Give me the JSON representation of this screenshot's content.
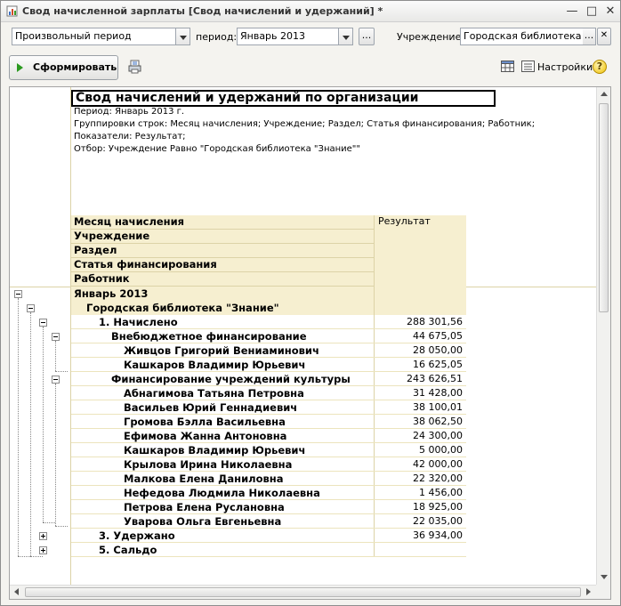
{
  "window": {
    "title": "Свод начисленной зарплаты [Свод начислений и удержаний] *"
  },
  "toolbar": {
    "period_type_value": "Произвольный период",
    "period_label": "период:",
    "period_value": "Январь 2013",
    "ellipsis_label": "...",
    "institution_label": "Учреждение:",
    "institution_value": "Городская библиотека \"Зн",
    "institution_btn_label": "...",
    "clear_label": "✕",
    "generate_label": "Сформировать",
    "settings_label": "Настройки",
    "help_label": "?"
  },
  "report": {
    "title": "Свод начислений и удержаний по организации",
    "info": [
      "Период: Январь 2013 г.",
      "Группировки строк: Месяц начисления; Учреждение; Раздел; Статья финансирования; Работник;",
      "Показатели: Результат;",
      "Отбор: Учреждение Равно \"Городская библиотека \"Знание\"\""
    ],
    "header_groups": [
      "Месяц начисления",
      "Учреждение",
      "Раздел",
      "Статья финансирования",
      "Работник"
    ],
    "result_header": "Результат",
    "rows": [
      {
        "name": "Январь 2013",
        "value": ""
      },
      {
        "name": "Городская библиотека \"Знание\"",
        "value": ""
      },
      {
        "name": "1. Начислено",
        "value": "288 301,56"
      },
      {
        "name": "Внебюджетное финансирование",
        "value": "44 675,05"
      },
      {
        "name": "Живцов Григорий Вениаминович",
        "value": "28 050,00"
      },
      {
        "name": "Кашкаров Владимир Юрьевич",
        "value": "16 625,05"
      },
      {
        "name": "Финансирование учреждений культуры",
        "value": "243 626,51"
      },
      {
        "name": "Абнагимова Татьяна Петровна",
        "value": "31 428,00"
      },
      {
        "name": "Васильев Юрий Геннадиевич",
        "value": "38 100,01"
      },
      {
        "name": "Громова Бэлла Васильевна",
        "value": "38 062,50"
      },
      {
        "name": "Ефимова Жанна Антоновна",
        "value": "24 300,00"
      },
      {
        "name": "Кашкаров Владимир Юрьевич",
        "value": "5 000,00"
      },
      {
        "name": "Крылова Ирина Николаевна",
        "value": "42 000,00"
      },
      {
        "name": "Малкова Елена Даниловна",
        "value": "22 320,00"
      },
      {
        "name": "Нефедова Людмила Николаевна",
        "value": "1 456,00"
      },
      {
        "name": "Петрова Елена Руслановна",
        "value": "18 925,00"
      },
      {
        "name": "Уварова Ольга Евгеньевна",
        "value": "22 035,00"
      },
      {
        "name": "3. Удержано",
        "value": "36 934,00"
      },
      {
        "name": "5. Сальдо",
        "value": ""
      }
    ]
  }
}
